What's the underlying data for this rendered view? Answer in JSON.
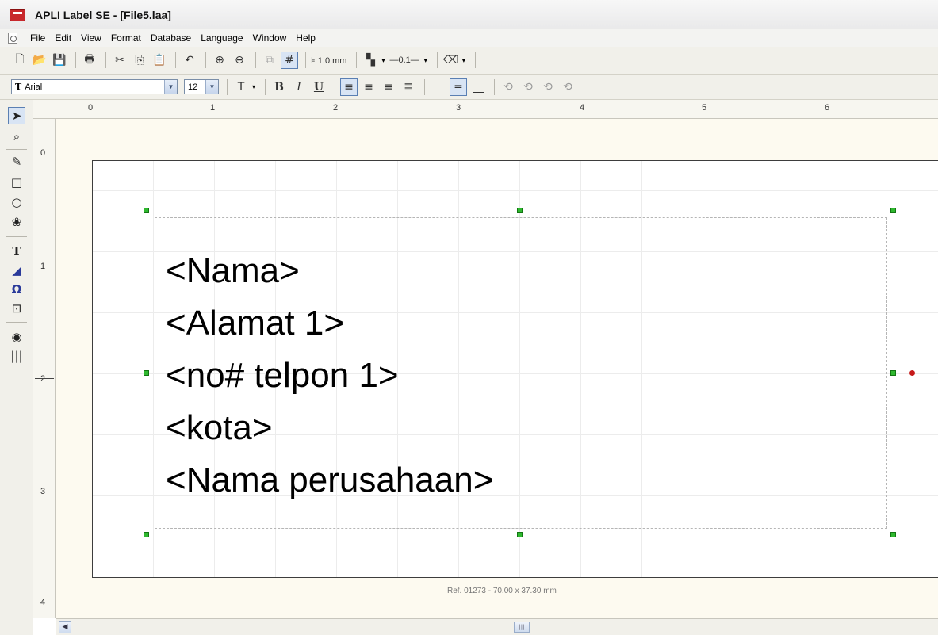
{
  "window": {
    "title": "APLI Label SE - [File5.laa]"
  },
  "menu": [
    "File",
    "Edit",
    "View",
    "Format",
    "Database",
    "Language",
    "Window",
    "Help"
  ],
  "toolbar": {
    "grid_size": "1.0 mm",
    "line_width": "—0.1—"
  },
  "format_bar": {
    "font_name": "Arial",
    "font_size": "12",
    "bold": "B",
    "italic": "I",
    "underline": "U"
  },
  "rulers": {
    "horizontal": [
      "0",
      "1",
      "2",
      "3",
      "4",
      "5",
      "6"
    ],
    "vertical": [
      "0",
      "1",
      "2",
      "3",
      "4"
    ]
  },
  "label": {
    "lines": [
      "<Nama>",
      "<Alamat 1>",
      "<no# telpon 1>",
      "<kota>",
      "<Nama perusahaan>"
    ],
    "ref": "Ref. 01273 - 70.00 x 37.30 mm"
  },
  "icons": {
    "left_tools": [
      "pointer-icon",
      "zoom-tool-icon",
      "pencil-icon",
      "rectangle-icon",
      "ellipse-icon",
      "image-icon",
      "text-icon",
      "vertical-text-icon",
      "symbol-icon",
      "field-icon",
      "preview-icon",
      "barcode-icon"
    ]
  }
}
